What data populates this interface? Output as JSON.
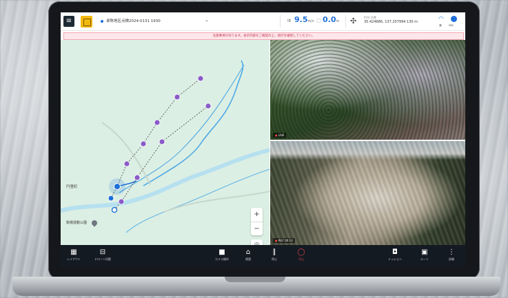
{
  "header": {
    "mission": "卓陈地区点検2024-0131 1930",
    "speed": "9.5",
    "speed_unit": "m/s",
    "altitude": "0.0",
    "altitude_unit": "m",
    "coord_label": "ROV 位置",
    "coordinates": "35.424686, 137.207994  130 m",
    "wifi_label": "通",
    "signal_label": "SBS"
  },
  "banner": "注意事項があります。表示内容をご確認の上、飛行を継続してください。",
  "map": {
    "town": "円里町",
    "place": "駒場運動公園",
    "waypoints": [
      "1",
      "2",
      "3",
      "4",
      "5",
      "6",
      "7",
      "8",
      "9"
    ]
  },
  "videos": [
    {
      "rec": "LIVE"
    },
    {
      "rec": "REC 00:13"
    }
  ],
  "bottom_bar": {
    "left": [
      {
        "icon": "layout-icon",
        "label": "レイアウト"
      },
      {
        "icon": "drone-icon",
        "label": "ドローン切替"
      }
    ],
    "center": [
      {
        "icon": "camera-icon",
        "label": "カメラ操作"
      },
      {
        "icon": "home-icon",
        "label": "帰還"
      },
      {
        "icon": "pause-icon",
        "label": "停止"
      },
      {
        "icon": "stop-icon",
        "label": "中止"
      }
    ],
    "right": [
      {
        "icon": "bag-icon",
        "label": "ミッション"
      },
      {
        "icon": "storage-icon",
        "label": "ルート"
      },
      {
        "icon": "more-icon",
        "label": "詳細"
      }
    ]
  },
  "colors": {
    "accent": "#1e6fd9",
    "bar": "#141a22",
    "banner_text": "#c0324a",
    "map_bg": "#dcefe4"
  }
}
